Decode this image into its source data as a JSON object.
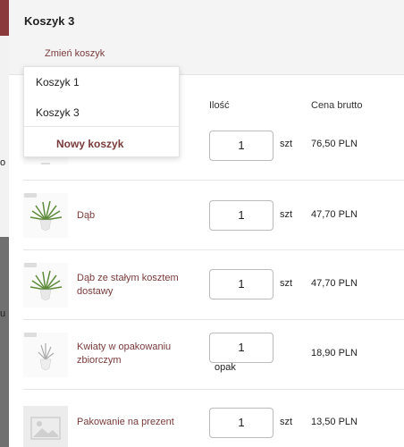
{
  "background": {
    "letter_a": "o",
    "letter_b": "u"
  },
  "cart": {
    "title": "Koszyk 3",
    "change_label": "Zmień koszyk"
  },
  "columns": {
    "quantity": "Ilość",
    "price": "Cena brutto"
  },
  "dropdown": {
    "items": [
      "Koszyk 1",
      "Koszyk 3"
    ],
    "new_cart": "Nowy koszyk"
  },
  "items": [
    {
      "name": "",
      "quantity": "1",
      "unit": "szt",
      "price": "76,50 PLN"
    },
    {
      "name": "Dąb",
      "quantity": "1",
      "unit": "szt",
      "price": "47,70 PLN"
    },
    {
      "name": "Dąb ze stałym kosztem dostawy",
      "quantity": "1",
      "unit": "szt",
      "price": "47,70 PLN"
    },
    {
      "name": "Kwiaty w opakowaniu zbiorczym",
      "quantity": "1",
      "unit": "opak",
      "price": "18,90 PLN"
    },
    {
      "name": "Pakowanie na prezent",
      "quantity": "1",
      "unit": "szt",
      "price": "13,50 PLN"
    }
  ]
}
